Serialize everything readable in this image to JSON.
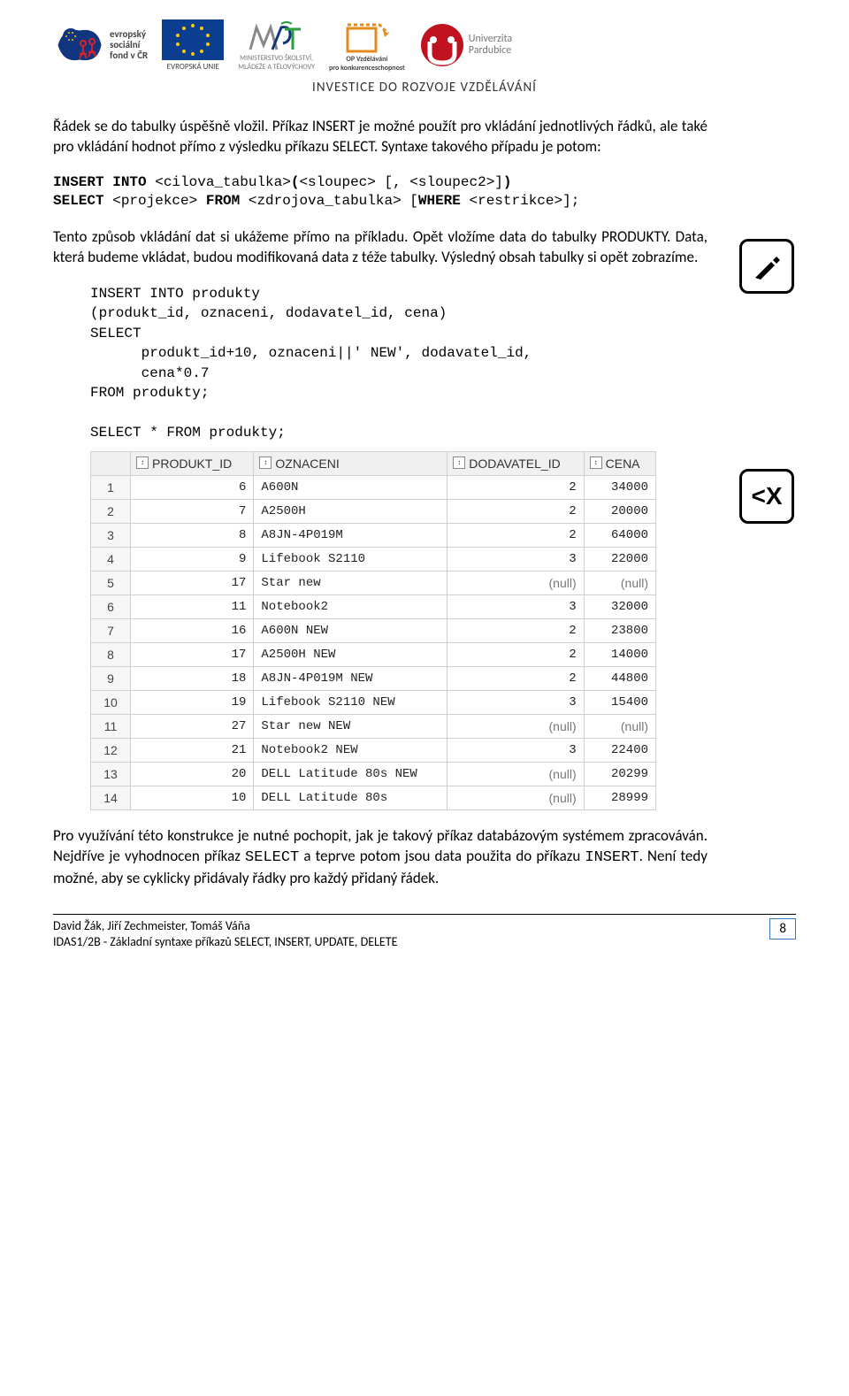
{
  "header": {
    "logo_esf_text": "evropský\nsociální\nfond v ČR",
    "logo_eu_text": "EVROPSKÁ UNIE",
    "logo_msmt_line1": "MINISTERSTVO ŠKOLSTVÍ,",
    "logo_msmt_line2": "MLÁDEŽE A TĚLOVÝCHOVY",
    "logo_op_line1": "OP Vzdělávání",
    "logo_op_line2": "pro konkurenceschopnost",
    "logo_upce": "Univerzita\nPardubice",
    "tagline": "INVESTICE DO ROZVOJE VZDĚLÁVÁNÍ"
  },
  "para1": "Řádek se do tabulky úspěšně vložil. Příkaz INSERT je možné použít pro vkládání jednotlivých řádků, ale také pro vkládání hodnot přímo z výsledku příkazu SELECT. Syntaxe takového případu je potom:",
  "code1_line1a": "INSERT INTO ",
  "code1_line1b": "<cilova_tabulka>",
  "code1_line1c": "(",
  "code1_line1d": "<sloupec> [, <sloupec2>]",
  "code1_line1e": ")",
  "code1_line2a": "SELECT ",
  "code1_line2b": "<projekce>",
  "code1_line2c": " FROM ",
  "code1_line2d": "<zdrojova_tabulka> [",
  "code1_line2e": "WHERE ",
  "code1_line2f": "<restrikce>];",
  "para2": "Tento způsob vkládání dat si ukážeme přímo na příkladu. Opět vložíme data do tabulky PRODUKTY. Data, která budeme vkládat, budou modifikovaná data z téže tabulky. Výsledný obsah tabulky si opět zobrazíme.",
  "code2": "INSERT INTO produkty\n(produkt_id, oznaceni, dodavatel_id, cena)\nSELECT\n      produkt_id+10, oznaceni||' NEW', dodavatel_id,\n      cena*0.7\nFROM produkty;\n\nSELECT * FROM produkty;",
  "table": {
    "headers": [
      "PRODUKT_ID",
      "OZNACENI",
      "DODAVATEL_ID",
      "CENA"
    ],
    "rows": [
      {
        "n": "1",
        "pid": "6",
        "oz": "A600N",
        "did": "2",
        "cena": "34000"
      },
      {
        "n": "2",
        "pid": "7",
        "oz": "A2500H",
        "did": "2",
        "cena": "20000"
      },
      {
        "n": "3",
        "pid": "8",
        "oz": "A8JN-4P019M",
        "did": "2",
        "cena": "64000"
      },
      {
        "n": "4",
        "pid": "9",
        "oz": "Lifebook S2110",
        "did": "3",
        "cena": "22000"
      },
      {
        "n": "5",
        "pid": "17",
        "oz": "Star new",
        "did": "(null)",
        "cena": "(null)"
      },
      {
        "n": "6",
        "pid": "11",
        "oz": "Notebook2",
        "did": "3",
        "cena": "32000"
      },
      {
        "n": "7",
        "pid": "16",
        "oz": "A600N NEW",
        "did": "2",
        "cena": "23800"
      },
      {
        "n": "8",
        "pid": "17",
        "oz": "A2500H NEW",
        "did": "2",
        "cena": "14000"
      },
      {
        "n": "9",
        "pid": "18",
        "oz": "A8JN-4P019M NEW",
        "did": "2",
        "cena": "44800"
      },
      {
        "n": "10",
        "pid": "19",
        "oz": "Lifebook S2110 NEW",
        "did": "3",
        "cena": "15400"
      },
      {
        "n": "11",
        "pid": "27",
        "oz": "Star new NEW",
        "did": "(null)",
        "cena": "(null)"
      },
      {
        "n": "12",
        "pid": "21",
        "oz": "Notebook2 NEW",
        "did": "3",
        "cena": "22400"
      },
      {
        "n": "13",
        "pid": "20",
        "oz": "DELL Latitude 80s NEW",
        "did": "(null)",
        "cena": "20299"
      },
      {
        "n": "14",
        "pid": "10",
        "oz": "DELL Latitude 80s",
        "did": "(null)",
        "cena": "28999"
      }
    ]
  },
  "para3_1": "Pro využívání této konstrukce je nutné pochopit, jak je takový příkaz databázovým systémem zpracováván. Nejdříve je vyhodnocen příkaz ",
  "para3_code1": "SELECT",
  "para3_2": " a teprve potom jsou data použita do příkazu ",
  "para3_code2": "INSERT",
  "para3_3": ". Není tedy možné, aby se cyklicky přidávaly řádky pro každý přidaný řádek.",
  "footer": {
    "authors": "David Žák, Jiří Zechmeister, Tomáš Váňa",
    "course": "IDAS1/2B - Základní syntaxe příkazů SELECT, INSERT, UPDATE, DELETE",
    "page": "8"
  },
  "icons": {
    "pencil": "✎",
    "code": "<X"
  }
}
